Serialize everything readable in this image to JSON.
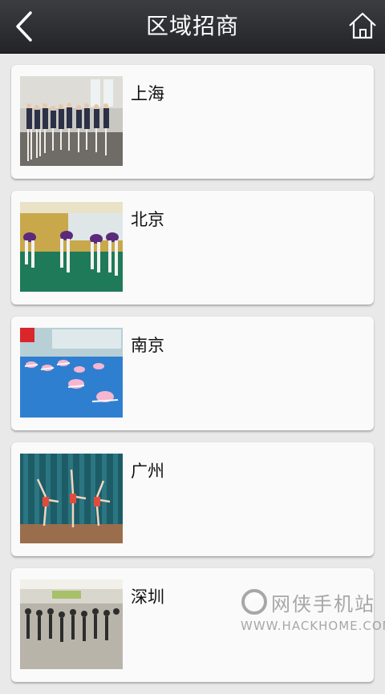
{
  "header": {
    "title": "区域招商",
    "back_icon": "chevron-left-icon",
    "home_icon": "home-icon"
  },
  "regions": [
    {
      "name": "上海",
      "image": "dance-class-photo"
    },
    {
      "name": "北京",
      "image": "dance-class-photo"
    },
    {
      "name": "南京",
      "image": "dance-class-photo"
    },
    {
      "name": "广州",
      "image": "dance-stage-photo"
    },
    {
      "name": "深圳",
      "image": "dance-class-photo"
    }
  ],
  "watermark": {
    "brand": "网侠手机站",
    "url": "WWW.HACKHOME.COM"
  },
  "colors": {
    "header": "#2e3033",
    "background": "#e9e9e9",
    "card": "#fafafa"
  }
}
